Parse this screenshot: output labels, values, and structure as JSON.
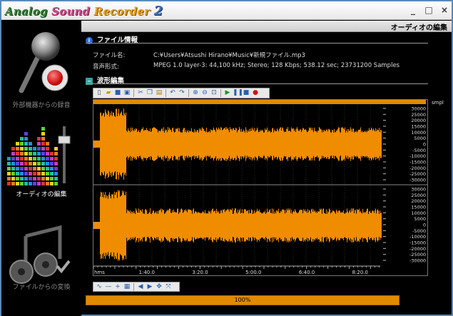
{
  "app": {
    "title_words": [
      "Analog",
      "Sound",
      "Recorder",
      "2"
    ]
  },
  "window_controls": {
    "minimize": "_",
    "restore": "□",
    "close": "×"
  },
  "sidebar": {
    "items": [
      {
        "label": "外部機器からの録音",
        "icon": "microphone-record-icon",
        "active": false
      },
      {
        "label": "オーディオの編集",
        "icon": "equalizer-fader-icon",
        "active": true
      },
      {
        "label": "ファイルからの変換",
        "icon": "music-note-disc-icon",
        "active": false
      }
    ]
  },
  "header": {
    "title": "オーディオの編集"
  },
  "file_info": {
    "section_title": "ファイル情報",
    "filename_label": "ファイル名:",
    "filename_value": "C:¥Users¥Atsushi Hirano¥Music¥新規ファイル.mp3",
    "format_label": "音声形式:",
    "format_value": "MPEG 1.0 layer-3: 44,100 kHz; Stereo; 128 Kbps; 538.12 sec; 23731200 Samples"
  },
  "wave_editor": {
    "section_title": "波形編集",
    "unit_label": "smpl",
    "hms_label": "hms",
    "time_labels": [
      "1:40.0",
      "3:20.0",
      "5:00.0",
      "6:40.0",
      "8:20.0"
    ],
    "y_ticks": [
      "30000",
      "25000",
      "20000",
      "15000",
      "10000",
      "5000",
      "0",
      "-5000",
      "-10000",
      "-15000",
      "-20000",
      "-25000",
      "-30000"
    ],
    "wave_color": "#f08c00"
  },
  "progress": {
    "value": 1.0,
    "text": "100%"
  }
}
